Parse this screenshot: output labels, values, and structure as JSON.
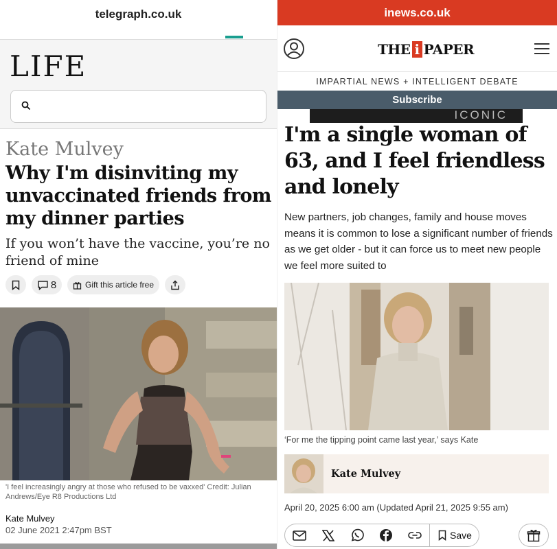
{
  "left": {
    "url": "telegraph.co.uk",
    "section_title": "LIFE",
    "author_kicker": "Kate Mulvey",
    "headline": "Why I'm disinviting my unvaccinated friends from my dinner parties",
    "standfirst": "If you won’t have the vaccine, you’re no friend of mine",
    "actions": {
      "comment_count": "8",
      "gift_label": "Gift this article free"
    },
    "caption": "'I feel increasingly angry at those who refused to be vaxxed'  Credit: Julian Andrews/Eye R8 Productions Ltd",
    "byline": {
      "name": "Kate Mulvey",
      "date": "02 June 2021 2:47pm BST"
    },
    "icons": [
      "search-icon",
      "bookmark-icon",
      "comment-icon",
      "gift-icon",
      "share-icon"
    ],
    "colors": {
      "accent": "#1a9e8f",
      "kicker": "#777777"
    }
  },
  "right": {
    "url": "inews.co.uk",
    "logo": {
      "before": "THE",
      "mark": "i",
      "after": "PAPER"
    },
    "tagline": "IMPARTIAL NEWS + INTELLIGENT DEBATE",
    "subscribe_label": "Subscribe",
    "ad_text": "ICONIC",
    "headline": "I'm a single woman of 63, and I feel friendless and lonely",
    "standfirst": "New partners, job changes, family and house moves means it is common to lose a significant number of friends as we get older - but it can force us to meet new people we feel more suited to",
    "caption": "‘For me the tipping point came last year,’ says Kate",
    "author": "Kate Mulvey",
    "dateline": "April 20, 2025 6:00 am (Updated April 21, 2025 9:55 am)",
    "share": {
      "save_label": "Save"
    },
    "icons": [
      "user-icon",
      "menu-icon",
      "email-icon",
      "x-icon",
      "whatsapp-icon",
      "facebook-icon",
      "link-icon",
      "bookmark-icon",
      "gift-icon"
    ],
    "colors": {
      "brand_red": "#d93a22",
      "subscribe_bg": "#4a5c6a"
    }
  }
}
